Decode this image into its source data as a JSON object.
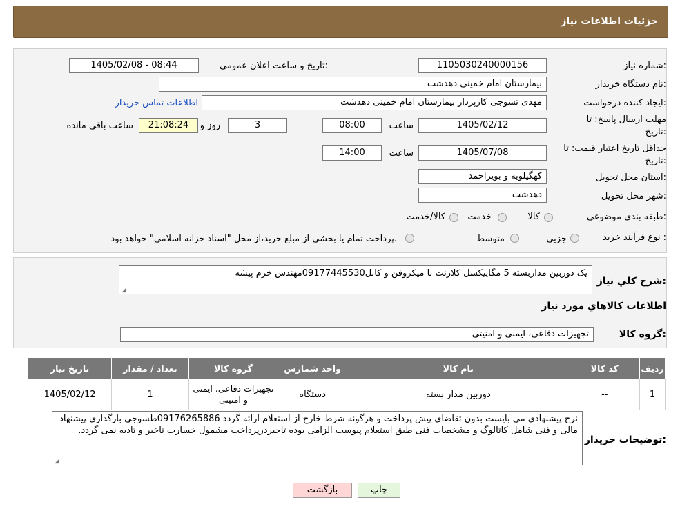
{
  "header": {
    "title": "جزئیات اطلاعات نیاز"
  },
  "form": {
    "need_number_label": "شماره نیاز:",
    "need_number": "1105030240000156",
    "announce_label": "تاریخ و ساعت اعلان عمومی:",
    "announce_value": "1405/02/08 - 08:44",
    "buyer_org_label": "نام دستگاه خریدار:",
    "buyer_org": "بیمارستان امام خمینی دهدشت",
    "requester_label": "ایجاد کننده درخواست:",
    "requester": "مهدی تسوجی کارپرداز بیمارستان امام خمینی دهدشت",
    "contact_link": "اطلاعات تماس خریدار",
    "deadline_label_1": "مهلت ارسال پاسخ: تا",
    "deadline_label_2": "تاریخ:",
    "deadline_date": "1405/02/12",
    "time_label": "ساعت",
    "deadline_time": "08:00",
    "days_value": "3",
    "days_label": "روز و",
    "remaining_time": "21:08:24",
    "remaining_label": "ساعت باقي مانده",
    "validity_label_1": "حداقل تاریخ اعتبار قیمت: تا",
    "validity_label_2": "تاریخ:",
    "validity_date": "1405/07/08",
    "validity_time": "14:00",
    "province_label": "استان محل تحویل:",
    "province": "کهگیلویه و بویراحمد",
    "city_label": "شهر محل تحویل:",
    "city": "دهدشت",
    "category_label": "طبقه بندی موضوعی:",
    "category_options": [
      "کالا",
      "خدمت",
      "کالا/خدمت"
    ],
    "process_label": "نوع فرآیند خرید :",
    "process_options": [
      "جزیي",
      "متوسط"
    ],
    "process_note": "پرداخت تمام یا بخشی از مبلغ خرید،از محل \"اسناد خزانه اسلامی\" خواهد بود."
  },
  "summary": {
    "label": "شرح کلي نياز:",
    "text": "یک دوربین مداربسته 5 مگاپیکسل کلارنت با میکروفن و کابل09177445530مهندس خرم پیشه",
    "goods_info_title": "اطلاعات کالاهاي مورد نياز",
    "goods_group_label": "گروه کالا:",
    "goods_group": "تجهیزات دفاعی، ایمنی و امنیتی"
  },
  "table": {
    "headers": [
      "ردیف",
      "کد کالا",
      "نام کالا",
      "واحد شمارش",
      "گروه کالا",
      "تعداد / مقدار",
      "تاریخ نیاز"
    ],
    "rows": [
      [
        "1",
        "--",
        "دوربین مدار بسته",
        "دستگاه",
        "تجهیزات دفاعی، ایمنی و امنیتی",
        "1",
        "1405/02/12"
      ]
    ]
  },
  "buyer_notes": {
    "label": "توضیحات خریدار:",
    "text": "نرخ پیشنهادی می بایست بدون تقاضای پیش پرداخت و هرگونه شرط خارج از استعلام ارائه گردد 09176265886طسوجی بارگذاری پیشنهاد مالی و فنی شامل کاتالوگ و مشخصات فنی طبق استعلام پیوست الزامی بوده تاخیردرپرداخت مشمول خسارت تاخیر و تادیه نمی گردد."
  },
  "buttons": {
    "print": "چاپ",
    "back": "بازگشت"
  },
  "colors": {
    "header_bg": "#8b6b42",
    "table_header_bg": "#787878",
    "back_button_bg": "#ffd6d6",
    "print_button_bg": "#e4f7dc"
  }
}
